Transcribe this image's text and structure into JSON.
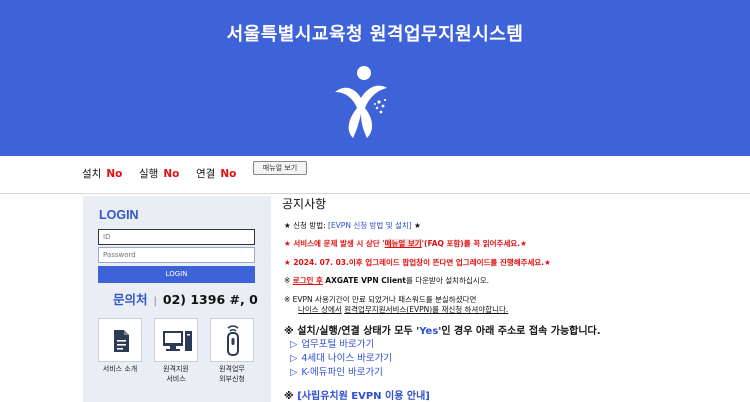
{
  "header": {
    "title": "서울특별시교육청 원격업무지원시스템"
  },
  "status": {
    "install_label": "설치",
    "install_value": "No",
    "run_label": "실행",
    "run_value": "No",
    "connect_label": "연결",
    "connect_value": "No",
    "manual_button": "매뉴얼 보기"
  },
  "login": {
    "title": "LOGIN",
    "id_placeholder": "ID",
    "password_placeholder": "Password",
    "button": "LOGIN"
  },
  "contact": {
    "label": "문의처",
    "separator": "|",
    "number": "02) 1396 #, 0"
  },
  "services": [
    {
      "label": "서비스 소개"
    },
    {
      "label1": "원격지원",
      "label2": "서비스"
    },
    {
      "label1": "원격업무",
      "label2": "외부신청"
    }
  ],
  "notice": {
    "title": "공지사항",
    "line1_prefix": "★ 신청 방법:",
    "line1_link": "[EVPN 신청 방법 및 설치]",
    "line1_suffix": "★",
    "line2_a": "★ 서비스에 문제 발생 시 상단 '",
    "line2_b": "매뉴얼 보기",
    "line2_c": "'(FAQ 포함)를 꼭 읽어주세요.★",
    "line3": "★ 2024. 07. 03.이후 업그레이드 팝업창이 뜬다면 업그레이드를 진행해주세요.★",
    "line4_a": "※",
    "line4_b": "로그인 후",
    "line4_c": "AXGATE VPN Client",
    "line4_d": "를 다운받아 설치하십시오.",
    "line5": "※ EVPN 사용기간이 만료 되었거나 패스워드를 분실하셨다면",
    "line6_a": "나이스 상에서",
    "line6_b": "원격업무지원서비스(EVPN)",
    "line6_c": "를 재신청 하셔야합니다.",
    "line7_a": "※ 설치/실행/연결 상태가 모두 '",
    "line7_b": "Yes",
    "line7_c": "'인 경우 아래 주소로 접속 가능합니다.",
    "links": [
      "업무포털 바로가기",
      "4세대 나이스 바로가기",
      "K-에듀파인 바로가기"
    ],
    "line8_a": "※",
    "line8_b": "[사립유치원 EVPN 이용 안내]"
  },
  "colors": {
    "brand_blue": "#3e63d8",
    "status_red": "#e01010",
    "link_blue": "#2d50d0"
  }
}
